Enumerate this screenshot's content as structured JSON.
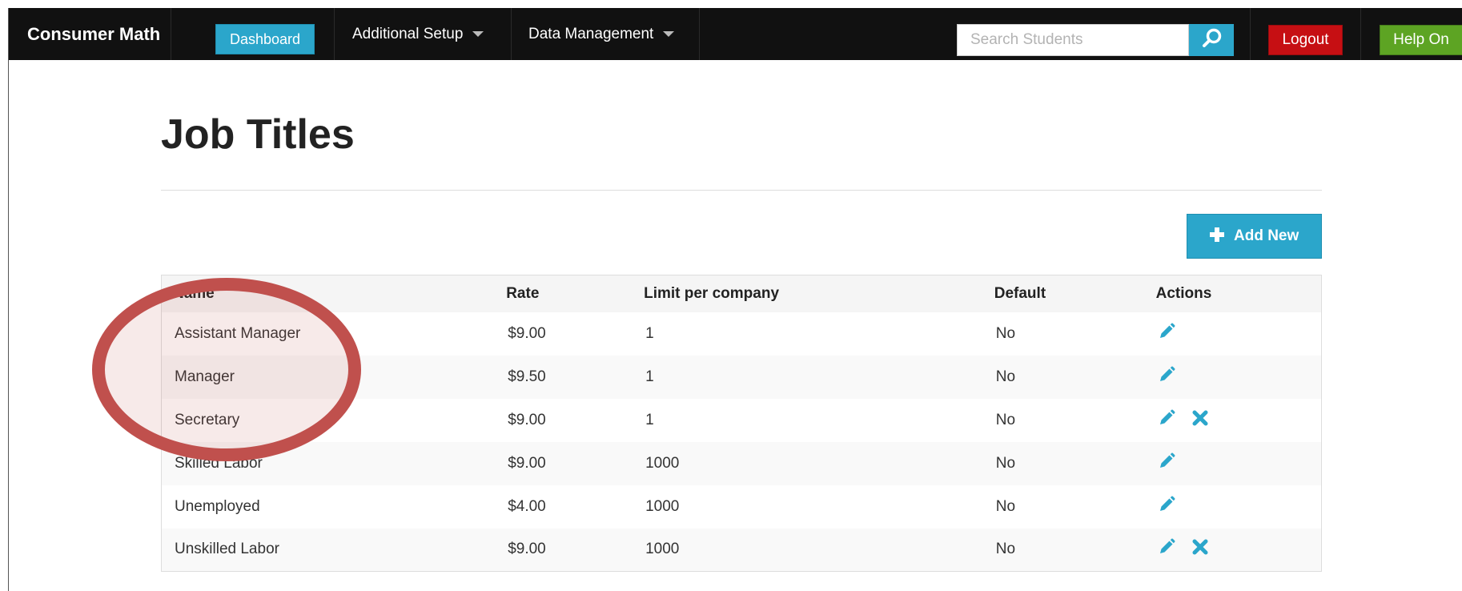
{
  "app": {
    "brand": "Consumer Math"
  },
  "nav": {
    "dashboard_label": "Dashboard",
    "additional_setup_label": "Additional Setup",
    "data_management_label": "Data Management",
    "search_placeholder": "Search Students",
    "logout_label": "Logout",
    "help_label": "Help On"
  },
  "page": {
    "title": "Job Titles",
    "add_new_label": "Add New"
  },
  "table": {
    "headers": [
      "Name",
      "Rate",
      "Limit per company",
      "Default",
      "Actions"
    ],
    "rows": [
      {
        "name": "Assistant Manager",
        "rate": "$9.00",
        "limit": "1",
        "default": "No",
        "deletable": false
      },
      {
        "name": "Manager",
        "rate": "$9.50",
        "limit": "1",
        "default": "No",
        "deletable": false
      },
      {
        "name": "Secretary",
        "rate": "$9.00",
        "limit": "1",
        "default": "No",
        "deletable": true
      },
      {
        "name": "Skilled Labor",
        "rate": "$9.00",
        "limit": "1000",
        "default": "No",
        "deletable": false
      },
      {
        "name": "Unemployed",
        "rate": "$4.00",
        "limit": "1000",
        "default": "No",
        "deletable": false
      },
      {
        "name": "Unskilled Labor",
        "rate": "$9.00",
        "limit": "1000",
        "default": "No",
        "deletable": true
      }
    ]
  },
  "icons": {
    "edit": "pencil-icon",
    "delete": "close-icon",
    "search": "search-icon",
    "add": "plus-icon",
    "caret": "caret-down-icon"
  },
  "colors": {
    "primary": "#2ba6cb",
    "danger": "#c60f13",
    "success": "#5da423",
    "annotation": "#c0504d",
    "navbar": "#111111"
  }
}
